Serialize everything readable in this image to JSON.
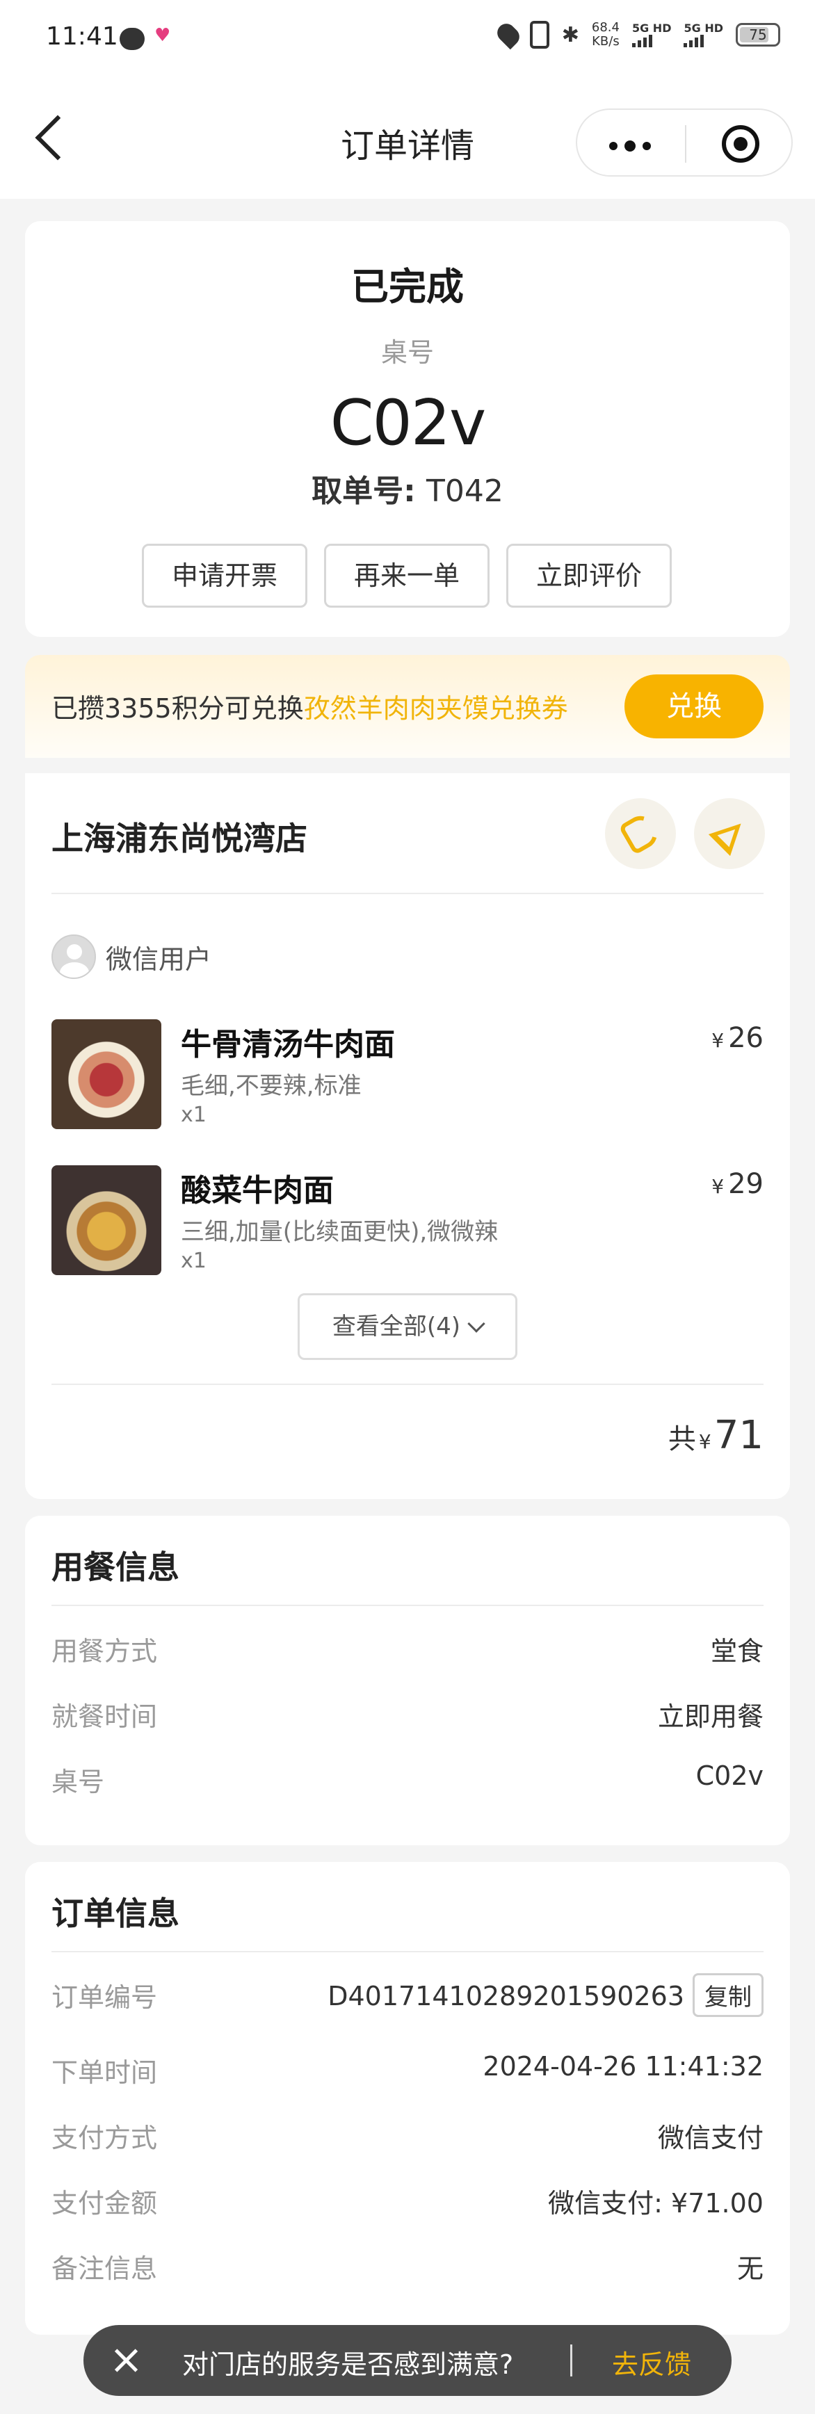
{
  "status_bar": {
    "time": "11:41",
    "speed_value": "68.4",
    "speed_unit": "KB/s",
    "sim1": "5G HD",
    "sim2": "5G HD",
    "battery": "75"
  },
  "nav": {
    "title": "订单详情"
  },
  "order_status": {
    "status": "已完成",
    "table_label": "桌号",
    "table_number": "C02v",
    "pickup_label": "取单号:",
    "pickup_number": "T042",
    "actions": [
      "申请开票",
      "再来一单",
      "立即评价"
    ]
  },
  "points_banner": {
    "prefix": "已攒3355积分可兑换",
    "highlight": "孜然羊肉肉夹馍兑换券",
    "button": "兑换",
    "accent_color": "#f8b300"
  },
  "store": {
    "name": "上海浦东尚悦湾店",
    "icons": [
      "phone-icon",
      "navigate-icon"
    ],
    "user_name": "微信用户",
    "items": [
      {
        "name": "牛骨清汤牛肉面",
        "spec": "毛细,不要辣,标准",
        "qty": "x1",
        "currency": "¥",
        "price": "26"
      },
      {
        "name": "酸菜牛肉面",
        "spec": "三细,加量(比续面更快),微微辣",
        "qty": "x1",
        "currency": "¥",
        "price": "29"
      }
    ],
    "view_all": "查看全部(4)",
    "total_label": "共",
    "total_currency": "¥",
    "total_amount": "71"
  },
  "dining_info": {
    "title": "用餐信息",
    "rows": [
      {
        "label": "用餐方式",
        "value": "堂食"
      },
      {
        "label": "就餐时间",
        "value": "立即用餐"
      },
      {
        "label": "桌号",
        "value": "C02v"
      }
    ]
  },
  "order_info": {
    "title": "订单信息",
    "order_no_label": "订单编号",
    "order_no": "D40171410289201590263",
    "copy": "复制",
    "rows": [
      {
        "label": "下单时间",
        "value": "2024-04-26 11:41:32"
      },
      {
        "label": "支付方式",
        "value": "微信支付"
      },
      {
        "label": "支付金额",
        "value": "微信支付: ¥71.00"
      },
      {
        "label": "备注信息",
        "value": "无"
      }
    ]
  },
  "toast": {
    "message": "对门店的服务是否感到满意?",
    "action": "去反馈"
  }
}
